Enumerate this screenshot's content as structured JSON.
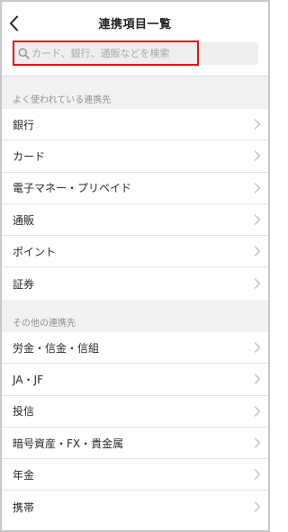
{
  "header": {
    "title": "連携項目一覧"
  },
  "search": {
    "placeholder": "カード、銀行、通販などを検索"
  },
  "sections": [
    {
      "title": "よく使われている連携先",
      "items": [
        "銀行",
        "カード",
        "電子マネー・プリペイド",
        "通販",
        "ポイント",
        "証券"
      ]
    },
    {
      "title": "その他の連携先",
      "items": [
        "労金・信金・信組",
        "JA・JF",
        "投信",
        "暗号資産・FX・貴金属",
        "年金",
        "携帯"
      ]
    }
  ],
  "icons": {
    "back": "chevron-left-icon",
    "search": "search-icon",
    "row": "chevron-right-icon"
  },
  "colors": {
    "highlight": "#e0131a",
    "section_bg": "#f2f2f4",
    "chevron": "#c4c4c7"
  }
}
